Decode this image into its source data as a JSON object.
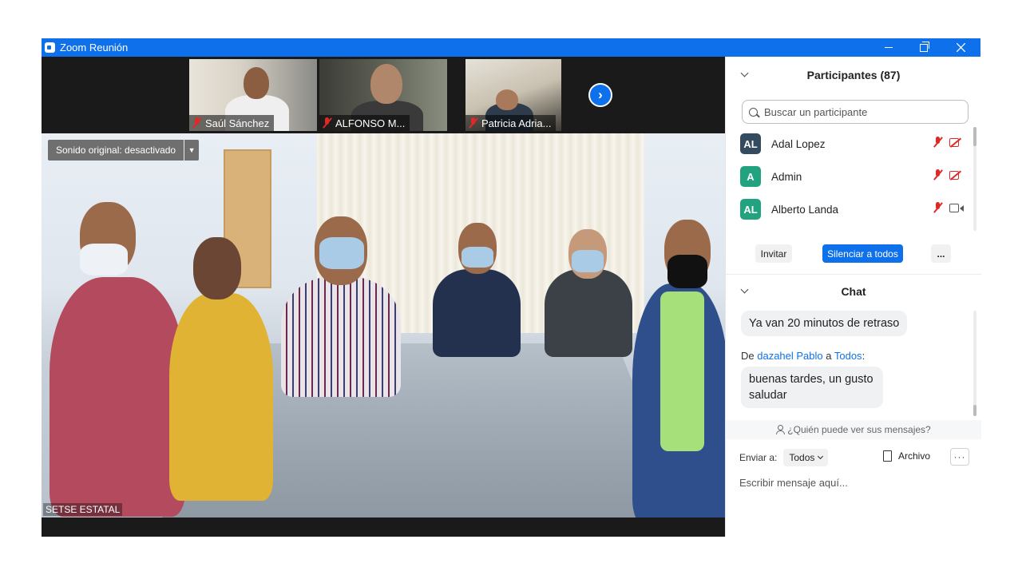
{
  "window": {
    "title": "Zoom Reunión"
  },
  "thumbnails": [
    {
      "name": "Saúl Sánchez"
    },
    {
      "name": "ALFONSO M..."
    },
    {
      "name": "Patricia Adria..."
    }
  ],
  "main_video": {
    "sound_button": "Sonido original: desactivado",
    "participant_name": "SETSE ESTATAL"
  },
  "participants": {
    "title": "Participantes (87)",
    "search_placeholder": "Buscar un participante",
    "list": [
      {
        "initials": "AL",
        "name": "Adal Lopez",
        "color": "#344a5e",
        "mic": "muted",
        "video": "off"
      },
      {
        "initials": "A",
        "name": "Admin",
        "color": "#23a27f",
        "mic": "muted",
        "video": "off"
      },
      {
        "initials": "AL",
        "name": "Alberto Landa",
        "color": "#23a27f",
        "mic": "muted",
        "video": "on"
      }
    ],
    "invite_label": "Invitar",
    "mute_all_label": "Silenciar a todos",
    "more_label": "..."
  },
  "chat": {
    "title": "Chat",
    "messages": [
      {
        "text": "Ya van 20 minutos de retraso"
      }
    ],
    "from_prefix": "De ",
    "from_sender": "dazahel Pablo",
    "from_mid": " a ",
    "from_recipient": "Todos",
    "from_suffix": ":",
    "message2": "buenas tardes, un gusto saludar",
    "who_can_see": "¿Quién puede ver sus mensajes?",
    "send_to_label": "Enviar a:",
    "send_to_value": "Todos",
    "file_label": "Archivo",
    "more_label": "···",
    "input_placeholder": "Escribir mensaje aquí..."
  }
}
